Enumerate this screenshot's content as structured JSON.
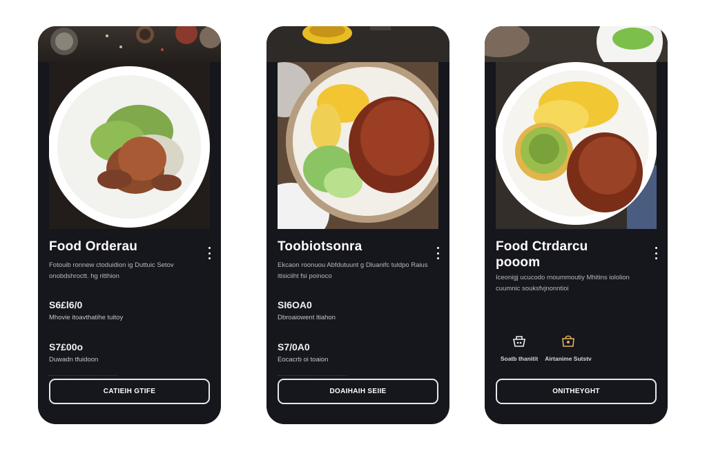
{
  "colors": {
    "card_background": "#16161d",
    "page_background": "#ffffff",
    "text_primary": "#ffffff",
    "text_secondary": "#b9b9c1",
    "button_border": "#e8e8ec"
  },
  "cards": [
    {
      "title": "Food Orderau",
      "description": "Fotouib ronnew ctoduidion ig Duttuic Setov onobdshroctt. hg ritthion",
      "prices": [
        {
          "amount": "S6£l6/0",
          "label": "Mhovie itoavthatihe tuitoy"
        },
        {
          "amount": "S7£00o",
          "label": "Duwadn tfuidoon"
        }
      ],
      "button_label": "CATIEIH GTIFE",
      "menu_icon": "more-vertical-icon"
    },
    {
      "title": "Toobiotsonra",
      "description": "Ekcaon roonuou Abfdutuunt g Dluanifc tuldpo Raius itisiciiht fsi poinoco",
      "prices": [
        {
          "amount": "SI6OA0",
          "label": "Dbroaiowent ltiahon"
        },
        {
          "amount": "S7/0A0",
          "label": "Eocacrb oi toaion"
        }
      ],
      "button_label": "DOAIHAIH SEIIE",
      "menu_icon": "more-vertical-icon"
    },
    {
      "title": "Food Ctrdarcu\npooom",
      "description": "Iceonigj ucucodo rnoummoutiy Mhitins iololion cuumnic souksfvjnonntioi",
      "features": [
        {
          "icon": "basket-icon",
          "label": "Soatb thanitit"
        },
        {
          "icon": "bag-icon",
          "label": "Airtanime Sutstv"
        }
      ],
      "button_label": "ONITHEYGHT",
      "menu_icon": "more-vertical-icon"
    }
  ]
}
